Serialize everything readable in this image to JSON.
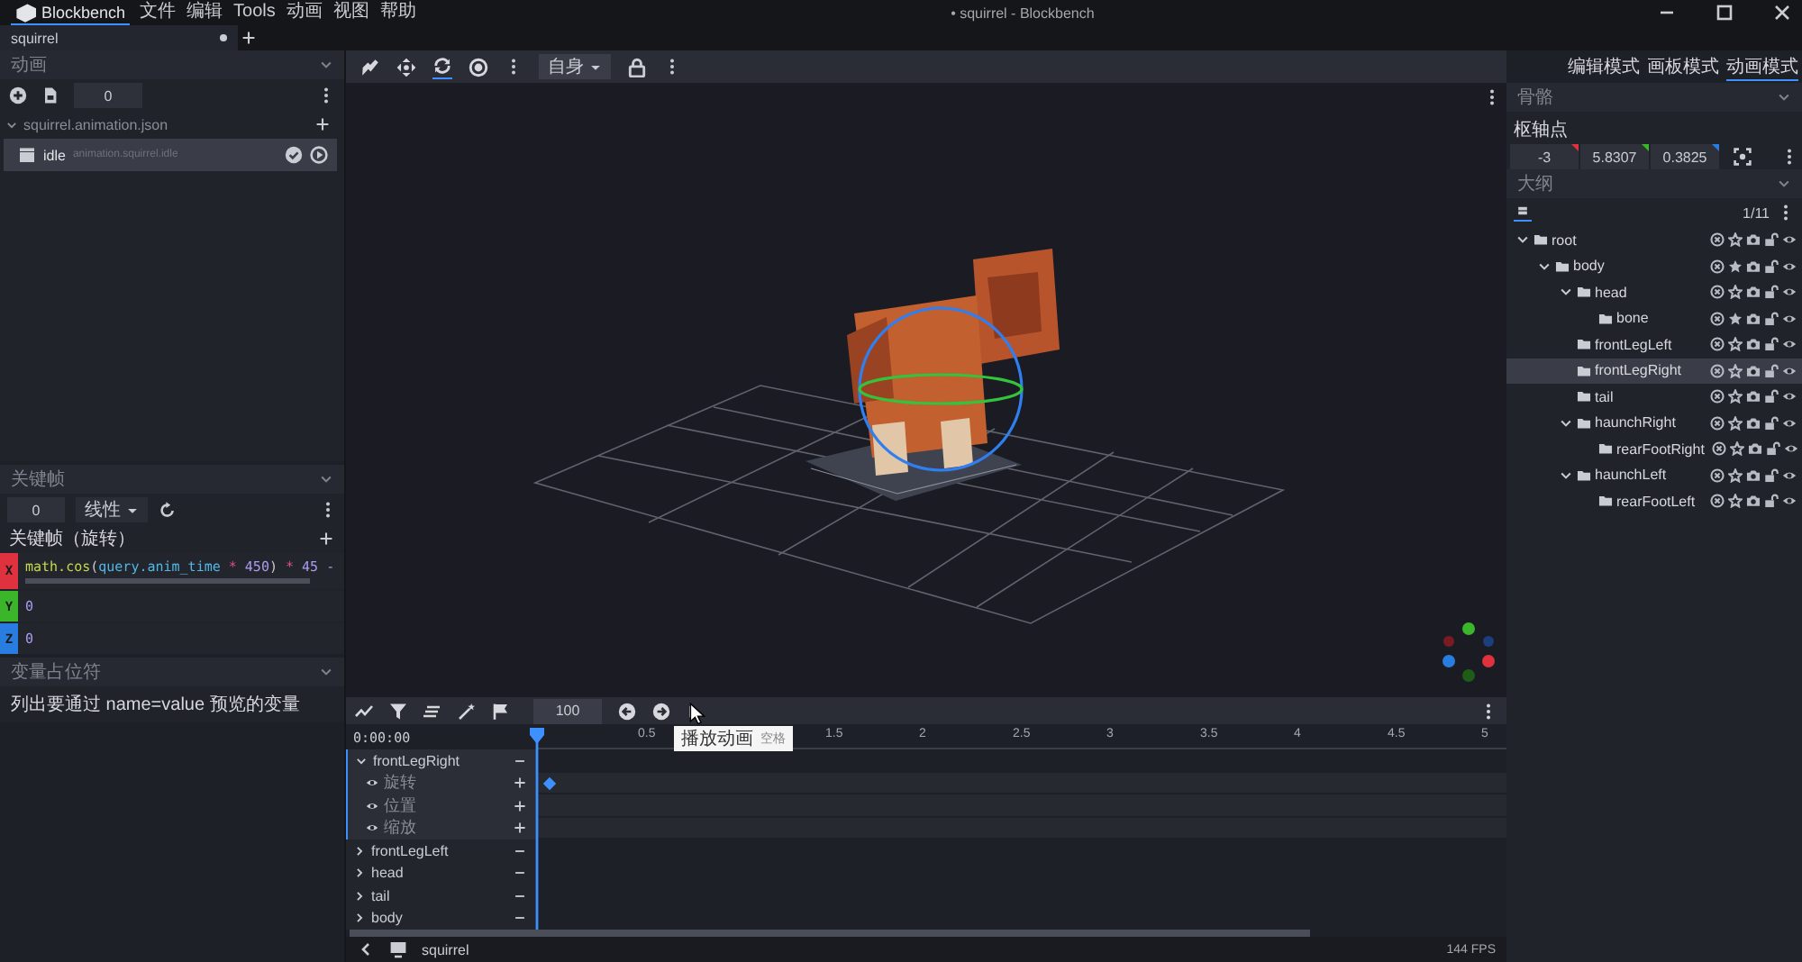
{
  "title_bar": {
    "app_menu": {
      "label": "Blockbench",
      "selected": true
    },
    "menus": [
      {
        "label": "文件",
        "selected": false
      },
      {
        "label": "编辑",
        "selected": false
      },
      {
        "label": "Tools",
        "selected": false
      },
      {
        "label": "动画",
        "selected": false
      },
      {
        "label": "视图",
        "selected": false
      },
      {
        "label": "帮助",
        "selected": false
      }
    ],
    "window_title": "• squirrel - Blockbench"
  },
  "tabs": [
    {
      "label": "squirrel",
      "unsaved": true,
      "selected": true
    }
  ],
  "animation_panel": {
    "title": "动画",
    "count": "0",
    "files": [
      {
        "name": "squirrel.animation.json",
        "expanded": true,
        "animations": [
          {
            "name": "idle",
            "path": "animation.squirrel.idle",
            "selected": true
          }
        ]
      }
    ]
  },
  "keyframe_panel": {
    "title": "关键帧",
    "time": "0",
    "interpolation": "线性",
    "channel_title": "关键帧（旋转）",
    "values": [
      {
        "axis": "X",
        "color": "#e0313f",
        "tokens": [
          {
            "text": "math.cos",
            "kind": "function"
          },
          {
            "text": "(",
            "kind": "plain"
          },
          {
            "text": "query.anim_time",
            "kind": "query"
          },
          {
            "text": " * ",
            "kind": "operator"
          },
          {
            "text": "450",
            "kind": "number"
          },
          {
            "text": ") ",
            "kind": "plain"
          },
          {
            "text": "* ",
            "kind": "operator"
          },
          {
            "text": "45 -",
            "kind": "number"
          }
        ]
      },
      {
        "axis": "Y",
        "color": "#3bb62a",
        "tokens": [
          {
            "text": "0",
            "kind": "number"
          }
        ]
      },
      {
        "axis": "Z",
        "color": "#2a7de0",
        "tokens": [
          {
            "text": "0",
            "kind": "number"
          }
        ]
      }
    ]
  },
  "variable_panel": {
    "title": "变量占位符",
    "hint": "列出要通过 name=value 预览的变量"
  },
  "viewport_toolbar": {
    "tools": [
      {
        "kind": "pose",
        "selected": false
      },
      {
        "kind": "move",
        "selected": false
      },
      {
        "kind": "rotate",
        "selected": true
      },
      {
        "kind": "pivot",
        "selected": false
      }
    ],
    "space": "自身"
  },
  "modes": [
    {
      "label": "编辑模式",
      "selected": false
    },
    {
      "label": "画板模式",
      "selected": false
    },
    {
      "label": "动画模式",
      "selected": true
    }
  ],
  "bone_panel": {
    "title": "骨骼",
    "pivot_label": "枢轴点",
    "pivot": [
      {
        "value": "-3",
        "color": "#e0313f"
      },
      {
        "value": "5.8307",
        "color": "#3bb62a"
      },
      {
        "value": "0.3825",
        "color": "#2a7de0"
      }
    ]
  },
  "outliner": {
    "title": "大纲",
    "count": "1/11",
    "tree": [
      {
        "name": "root",
        "expanded": true,
        "selected": false,
        "starred": false,
        "children": [
          {
            "name": "body",
            "expanded": true,
            "selected": false,
            "starred": true,
            "children": [
              {
                "name": "head",
                "expanded": true,
                "selected": false,
                "starred": false,
                "children": [
                  {
                    "name": "bone",
                    "selected": false,
                    "starred": true
                  }
                ]
              },
              {
                "name": "frontLegLeft",
                "selected": false,
                "starred": false
              },
              {
                "name": "frontLegRight",
                "selected": true,
                "starred": false
              },
              {
                "name": "tail",
                "selected": false,
                "starred": false
              },
              {
                "name": "haunchRight",
                "expanded": true,
                "selected": false,
                "starred": false,
                "children": [
                  {
                    "name": "rearFootRight",
                    "selected": false,
                    "starred": false
                  }
                ]
              },
              {
                "name": "haunchLeft",
                "expanded": true,
                "selected": false,
                "starred": false,
                "children": [
                  {
                    "name": "rearFootLeft",
                    "selected": false,
                    "starred": false
                  }
                ]
              }
            ]
          }
        ]
      }
    ]
  },
  "timeline": {
    "snap": "100",
    "time": "0:00:00",
    "ticks": [
      "0.5",
      "1.5",
      "2",
      "2.5",
      "3",
      "3.5",
      "4",
      "4.5",
      "5"
    ],
    "tooltip": {
      "label": "播放动画",
      "shortcut": "空格"
    },
    "animators": [
      {
        "name": "frontLegRight",
        "expanded": true,
        "selected": true,
        "channels": [
          {
            "name": "旋转",
            "keyframe": true
          },
          {
            "name": "位置",
            "keyframe": false
          },
          {
            "name": "缩放",
            "keyframe": false
          }
        ]
      },
      {
        "name": "frontLegLeft",
        "expanded": false,
        "selected": false
      },
      {
        "name": "head",
        "expanded": false,
        "selected": false
      },
      {
        "name": "tail",
        "expanded": false,
        "selected": false
      },
      {
        "name": "body",
        "expanded": false,
        "selected": false
      }
    ]
  },
  "status_bar": {
    "scene": "squirrel",
    "fps": "144 FPS"
  }
}
